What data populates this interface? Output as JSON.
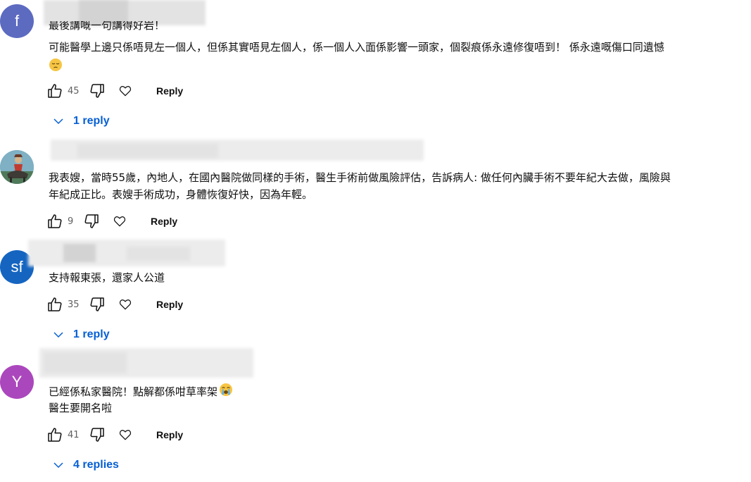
{
  "comments": [
    {
      "avatar_letter": "f",
      "avatar_color": "#5c6bc0",
      "text_lines": [
        "最後講嘅一句講得好岩！",
        "可能醫學上邊只係唔見左一個人，但係其實唔見左個人，係一個人入面係影響一頭家，個裂痕係永遠修復唔到！ 係永遠嘅傷口同遺憾"
      ],
      "emoji": "pensive-face-emoji",
      "likes": "45",
      "reply_label": "Reply",
      "replies_label": "1 reply"
    },
    {
      "avatar_icon": "rider-photo-avatar",
      "text_lines": [
        "我表嫂，當時55歲，內地人，在國內醫院做同樣的手術，醫生手術前做風險評估，告訴病人: 做任何內臟手術不要年紀大去做，風險與",
        "年紀成正比。表嫂手術成功，身體恢復好快，因為年輕。"
      ],
      "likes": "9",
      "reply_label": "Reply"
    },
    {
      "avatar_letter": "sf",
      "avatar_color": "#1565c0",
      "text_lines": [
        "支持報東張，還家人公道"
      ],
      "likes": "35",
      "reply_label": "Reply",
      "replies_label": "1 reply"
    },
    {
      "avatar_letter": "Y",
      "avatar_color": "#ab47bc",
      "text_lines": [
        "已經係私家醫院！點解都係咁草率架",
        "醫生要開名啦"
      ],
      "emoji": "loudly-crying-face-emoji",
      "likes": "41",
      "reply_label": "Reply",
      "replies_label": "4 replies"
    }
  ]
}
